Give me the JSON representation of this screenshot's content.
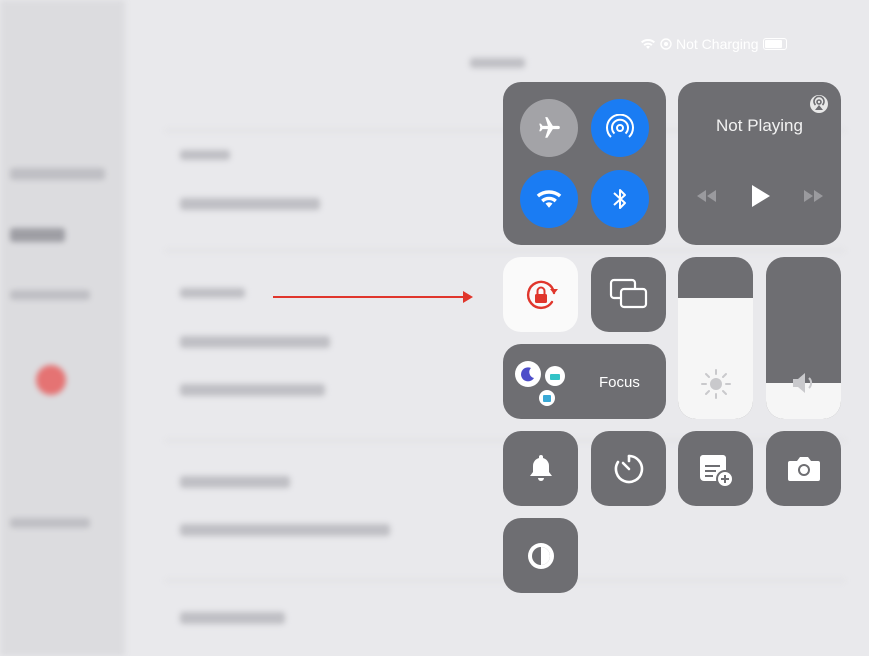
{
  "status_bar": {
    "charging_text": "Not Charging"
  },
  "now_playing": {
    "title": "Not Playing"
  },
  "focus": {
    "label": "Focus"
  },
  "levels": {
    "brightness": 0.75,
    "volume": 0.22
  },
  "colors": {
    "accent_blue": "#1a7cf3",
    "lock_red": "#e0362c",
    "tile_gray": "#6e6e72"
  },
  "icons": [
    "airplane-icon",
    "airdrop-icon",
    "wifi-icon",
    "bluetooth-icon",
    "airplay-icon",
    "rewind-icon",
    "play-icon",
    "fast-forward-icon",
    "rotation-lock-icon",
    "screen-mirroring-icon",
    "brightness-icon",
    "volume-icon",
    "moon-icon",
    "bell-icon",
    "timer-icon",
    "notes-icon",
    "camera-icon",
    "dark-mode-icon"
  ]
}
